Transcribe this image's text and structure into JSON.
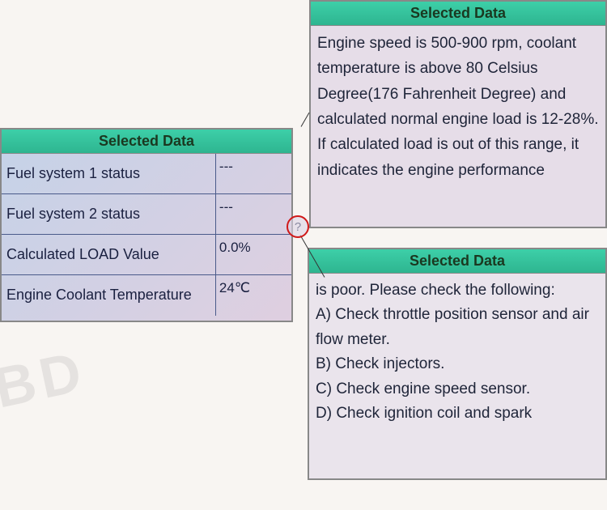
{
  "left": {
    "title": "Selected Data",
    "rows": [
      {
        "label": "Fuel system 1 status",
        "value": "---"
      },
      {
        "label": "Fuel system 2 status",
        "value": "---"
      },
      {
        "label": "Calculated LOAD Value",
        "value": "0.0%"
      },
      {
        "label": "Engine Coolant Temperature",
        "value": "24℃"
      }
    ]
  },
  "right_top": {
    "title": "Selected Data",
    "text": " Engine speed is 500-900 rpm, coolant temperature is above 80 Celsius Degree(176 Fahrenheit Degree) and calculated normal engine load is 12-28%. If calculated  load is out of this range, it indicates the engine performance"
  },
  "right_bottom": {
    "title": "Selected Data",
    "text_intro": " is poor. Please check the following:",
    "items": [
      " A) Check throttle position sensor and air flow meter.",
      " B) Check injectors.",
      " C) Check engine speed sensor.",
      " D) Check ignition coil and spark"
    ]
  },
  "help": {
    "symbol": "?"
  },
  "watermark": "OBD"
}
